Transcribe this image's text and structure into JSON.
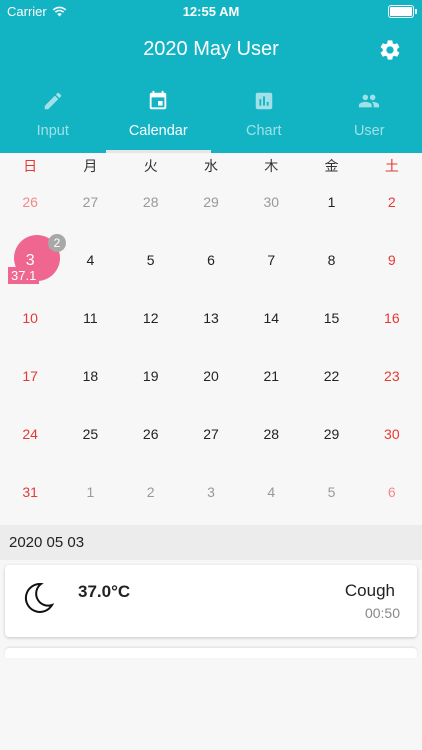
{
  "status_bar": {
    "carrier": "Carrier",
    "time": "12:55 AM"
  },
  "header": {
    "title": "2020 May User"
  },
  "tabs": [
    {
      "label": "Input",
      "icon": "pencil-icon",
      "active": false
    },
    {
      "label": "Calendar",
      "icon": "calendar-icon",
      "active": true
    },
    {
      "label": "Chart",
      "icon": "bar-chart-icon",
      "active": false
    },
    {
      "label": "User",
      "icon": "people-icon",
      "active": false
    }
  ],
  "weekdays": [
    "日",
    "月",
    "火",
    "水",
    "木",
    "金",
    "土"
  ],
  "calendar": {
    "weeks": [
      [
        {
          "day": "26",
          "out": true
        },
        {
          "day": "27",
          "out": true
        },
        {
          "day": "28",
          "out": true
        },
        {
          "day": "29",
          "out": true
        },
        {
          "day": "30",
          "out": true
        },
        {
          "day": "1"
        },
        {
          "day": "2"
        }
      ],
      [
        {
          "day": "3",
          "selected": true,
          "badge": "2",
          "temp": "37.1"
        },
        {
          "day": "4"
        },
        {
          "day": "5"
        },
        {
          "day": "6"
        },
        {
          "day": "7"
        },
        {
          "day": "8"
        },
        {
          "day": "9"
        }
      ],
      [
        {
          "day": "10"
        },
        {
          "day": "11"
        },
        {
          "day": "12"
        },
        {
          "day": "13"
        },
        {
          "day": "14"
        },
        {
          "day": "15"
        },
        {
          "day": "16"
        }
      ],
      [
        {
          "day": "17"
        },
        {
          "day": "18"
        },
        {
          "day": "19"
        },
        {
          "day": "20"
        },
        {
          "day": "21"
        },
        {
          "day": "22"
        },
        {
          "day": "23"
        }
      ],
      [
        {
          "day": "24"
        },
        {
          "day": "25"
        },
        {
          "day": "26"
        },
        {
          "day": "27"
        },
        {
          "day": "28"
        },
        {
          "day": "29"
        },
        {
          "day": "30"
        }
      ],
      [
        {
          "day": "31"
        },
        {
          "day": "1",
          "out": true
        },
        {
          "day": "2",
          "out": true
        },
        {
          "day": "3",
          "out": true
        },
        {
          "day": "4",
          "out": true
        },
        {
          "day": "5",
          "out": true
        },
        {
          "day": "6",
          "out": true
        }
      ]
    ]
  },
  "selected_date": {
    "label": "2020 05 03"
  },
  "records": [
    {
      "icon": "moon-icon",
      "temperature": "37.0°C",
      "symptom": "Cough",
      "time": "00:50"
    }
  ],
  "colors": {
    "header": "#12b3c3",
    "selected": "#ef6690",
    "weekend": "#e53935",
    "badge": "#a8a8a8"
  }
}
